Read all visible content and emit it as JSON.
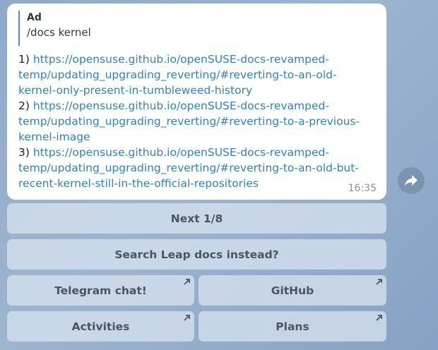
{
  "message": {
    "reply": {
      "sender": "Ad",
      "text": "/docs kernel"
    },
    "items": [
      {
        "num": "1)",
        "url": "https://opensuse.github.io/openSUSE-docs-revamped-temp/updating_upgrading_reverting/#reverting-to-an-old-kernel-only-present-in-tumbleweed-history"
      },
      {
        "num": "2)",
        "url": "https://opensuse.github.io/openSUSE-docs-revamped-temp/updating_upgrading_reverting/#reverting-to-a-previous-kernel-image"
      },
      {
        "num": "3)",
        "url": "https://opensuse.github.io/openSUSE-docs-revamped-temp/updating_upgrading_reverting/#reverting-to-an-old-but-recent-kernel-still-in-the-official-repositories"
      }
    ],
    "time": "16:35"
  },
  "forward_button": {
    "icon": "forward-arrow-icon"
  },
  "keyboard": {
    "next": "Next 1/8",
    "search_leap": "Search Leap docs instead?",
    "telegram_chat": "Telegram chat!",
    "github": "GitHub",
    "activities": "Activities",
    "plans": "Plans",
    "external_link_icon": "arrow-up-right-icon"
  }
}
